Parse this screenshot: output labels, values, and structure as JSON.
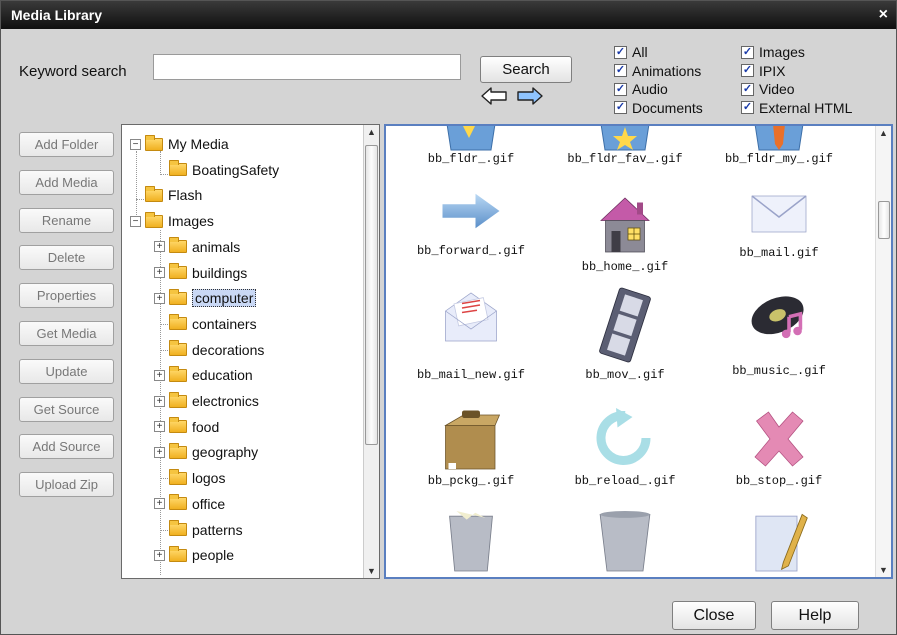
{
  "window": {
    "title": "Media Library",
    "close_glyph": "×"
  },
  "search": {
    "label": "Keyword search",
    "value": "",
    "placeholder": "",
    "button_label": "Search",
    "back_icon": "arrow-left-icon",
    "forward_icon": "arrow-right-icon"
  },
  "filters": {
    "col1": [
      {
        "label": "All",
        "checked": true
      },
      {
        "label": "Animations",
        "checked": true
      },
      {
        "label": "Audio",
        "checked": true
      },
      {
        "label": "Documents",
        "checked": true
      }
    ],
    "col2": [
      {
        "label": "Images",
        "checked": true
      },
      {
        "label": "IPIX",
        "checked": true
      },
      {
        "label": "Video",
        "checked": true
      },
      {
        "label": "External HTML",
        "checked": true
      }
    ],
    "check_glyph": "✓"
  },
  "side_buttons": [
    "Add Folder",
    "Add Media",
    "Rename",
    "Delete",
    "Properties",
    "Get Media",
    "Update",
    "Get Source",
    "Add Source",
    "Upload Zip"
  ],
  "tree": {
    "expand_glyph": "+",
    "collapse_glyph": "−",
    "nodes": [
      {
        "label": "My Media",
        "level": 0,
        "toggle": "collapse"
      },
      {
        "label": "BoatingSafety",
        "level": 1,
        "toggle": "none"
      },
      {
        "label": "Flash",
        "level": 0,
        "toggle": "none"
      },
      {
        "label": "Images",
        "level": 0,
        "toggle": "collapse"
      },
      {
        "label": "animals",
        "level": 1,
        "toggle": "expand"
      },
      {
        "label": "buildings",
        "level": 1,
        "toggle": "expand"
      },
      {
        "label": "computer",
        "level": 1,
        "toggle": "expand",
        "selected": true
      },
      {
        "label": "containers",
        "level": 1,
        "toggle": "none"
      },
      {
        "label": "decorations",
        "level": 1,
        "toggle": "none"
      },
      {
        "label": "education",
        "level": 1,
        "toggle": "expand"
      },
      {
        "label": "electronics",
        "level": 1,
        "toggle": "expand"
      },
      {
        "label": "food",
        "level": 1,
        "toggle": "expand"
      },
      {
        "label": "geography",
        "level": 1,
        "toggle": "expand"
      },
      {
        "label": "logos",
        "level": 1,
        "toggle": "none"
      },
      {
        "label": "office",
        "level": 1,
        "toggle": "expand"
      },
      {
        "label": "patterns",
        "level": 1,
        "toggle": "none"
      },
      {
        "label": "people",
        "level": 1,
        "toggle": "expand"
      }
    ]
  },
  "files": [
    {
      "caption": "bb_fldr_.gif",
      "icon": "folder-icon"
    },
    {
      "caption": "bb_fldr_fav_.gif",
      "icon": "favorite-folder-icon"
    },
    {
      "caption": "bb_fldr_my_.gif",
      "icon": "my-folder-icon"
    },
    {
      "caption": "bb_forward_.gif",
      "icon": "forward-arrow-icon"
    },
    {
      "caption": "bb_home_.gif",
      "icon": "home-icon"
    },
    {
      "caption": "bb_mail.gif",
      "icon": "mail-icon"
    },
    {
      "caption": "bb_mail_new.gif",
      "icon": "new-mail-icon"
    },
    {
      "caption": "bb_mov_.gif",
      "icon": "film-icon"
    },
    {
      "caption": "bb_music_.gif",
      "icon": "music-record-icon"
    },
    {
      "caption": "bb_pckg_.gif",
      "icon": "package-icon"
    },
    {
      "caption": "bb_reload_.gif",
      "icon": "reload-icon"
    },
    {
      "caption": "bb_stop_.gif",
      "icon": "stop-icon"
    },
    {
      "caption": "",
      "icon": "full-trash-icon"
    },
    {
      "caption": "",
      "icon": "empty-trash-icon"
    },
    {
      "caption": "",
      "icon": "edit-document-icon"
    }
  ],
  "footer": {
    "close_label": "Close",
    "help_label": "Help"
  },
  "colors": {
    "titlebar": "#1a1a1a",
    "selection": "#c9d8f5",
    "grid_border": "#5a7fc0",
    "check": "#1a3aa8",
    "arrow_fill": "#8fc4ff"
  }
}
